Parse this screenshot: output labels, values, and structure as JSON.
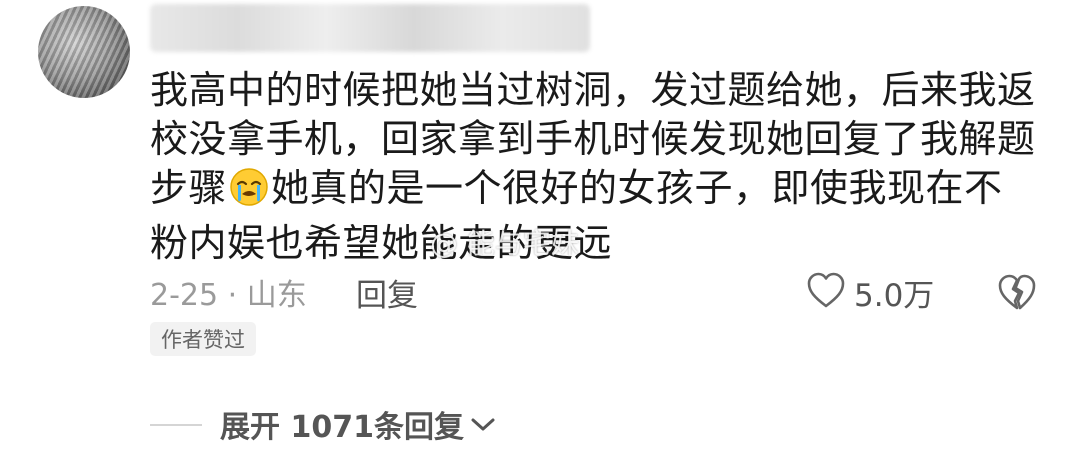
{
  "comment": {
    "username_redacted": true,
    "text_line1": "我高中的时候把她当过树洞，发过题给她，后来我返",
    "text_line2": "校没拿手机，回家拿到手机时候发现她回复了我解题",
    "text_line3_before_emoji": "步骤",
    "emoji_name": "loudly-crying-face-icon",
    "text_line3_after_emoji": "她真的是一个很好的女孩子，即使我现在不",
    "text_line4": "粉内娱也希望她能走的更远",
    "watermark": "@ 能与宅妹"
  },
  "meta": {
    "date_location": "2-25 · 山东",
    "reply_label": "回复",
    "like_count": "5.0万",
    "like_icon": "heart-icon",
    "dislike_icon": "broken-heart-icon"
  },
  "tags": {
    "author_liked": "作者赞过"
  },
  "replies": {
    "expand_label": "展开 1071条回复",
    "chevron_icon": "chevron-down-icon"
  },
  "colors": {
    "text": "#1a1a1a",
    "muted": "#9a9a9a",
    "action": "#555555",
    "tag_bg": "#f2f2f2"
  }
}
